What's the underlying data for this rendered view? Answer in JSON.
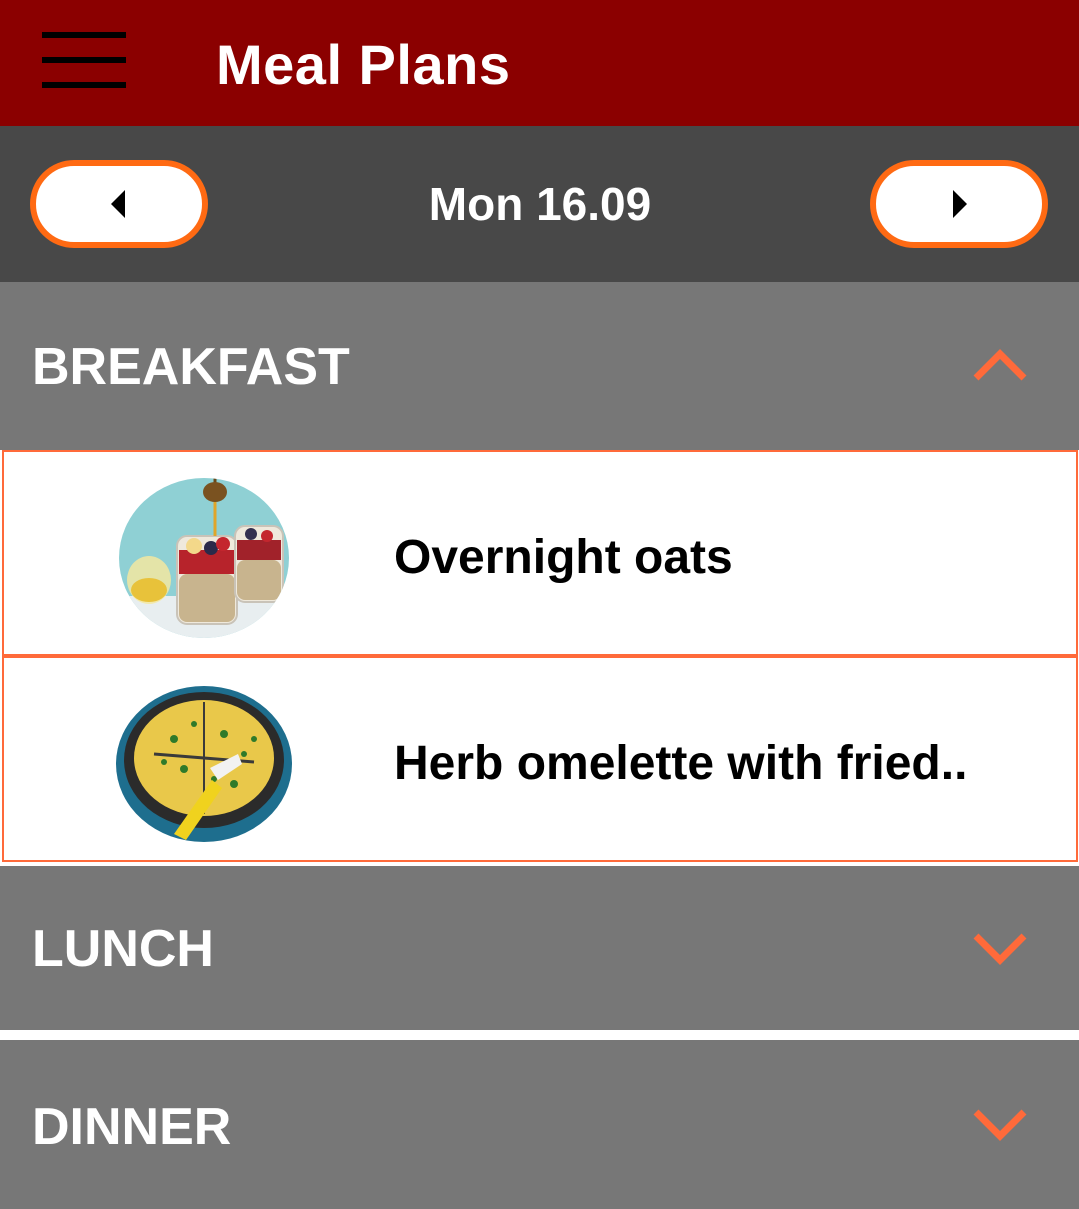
{
  "appbar": {
    "title": "Meal Plans",
    "menu_icon": "hamburger-menu-icon",
    "background": "#8b0000"
  },
  "date_nav": {
    "date_label": "Mon 16.09",
    "prev_icon": "caret-left-icon",
    "next_icon": "caret-right-icon",
    "accent": "#ff6a13"
  },
  "sections": [
    {
      "title": "BREAKFAST",
      "expanded": true,
      "chevron_icon": "chevron-up-icon",
      "items": [
        {
          "name": "Overnight oats",
          "image": "overnight-oats-photo"
        },
        {
          "name": "Herb omelette with fried..",
          "image": "herb-omelette-photo"
        }
      ]
    },
    {
      "title": "LUNCH",
      "expanded": false,
      "chevron_icon": "chevron-down-icon",
      "items": []
    },
    {
      "title": "DINNER",
      "expanded": false,
      "chevron_icon": "chevron-down-icon",
      "items": []
    }
  ]
}
